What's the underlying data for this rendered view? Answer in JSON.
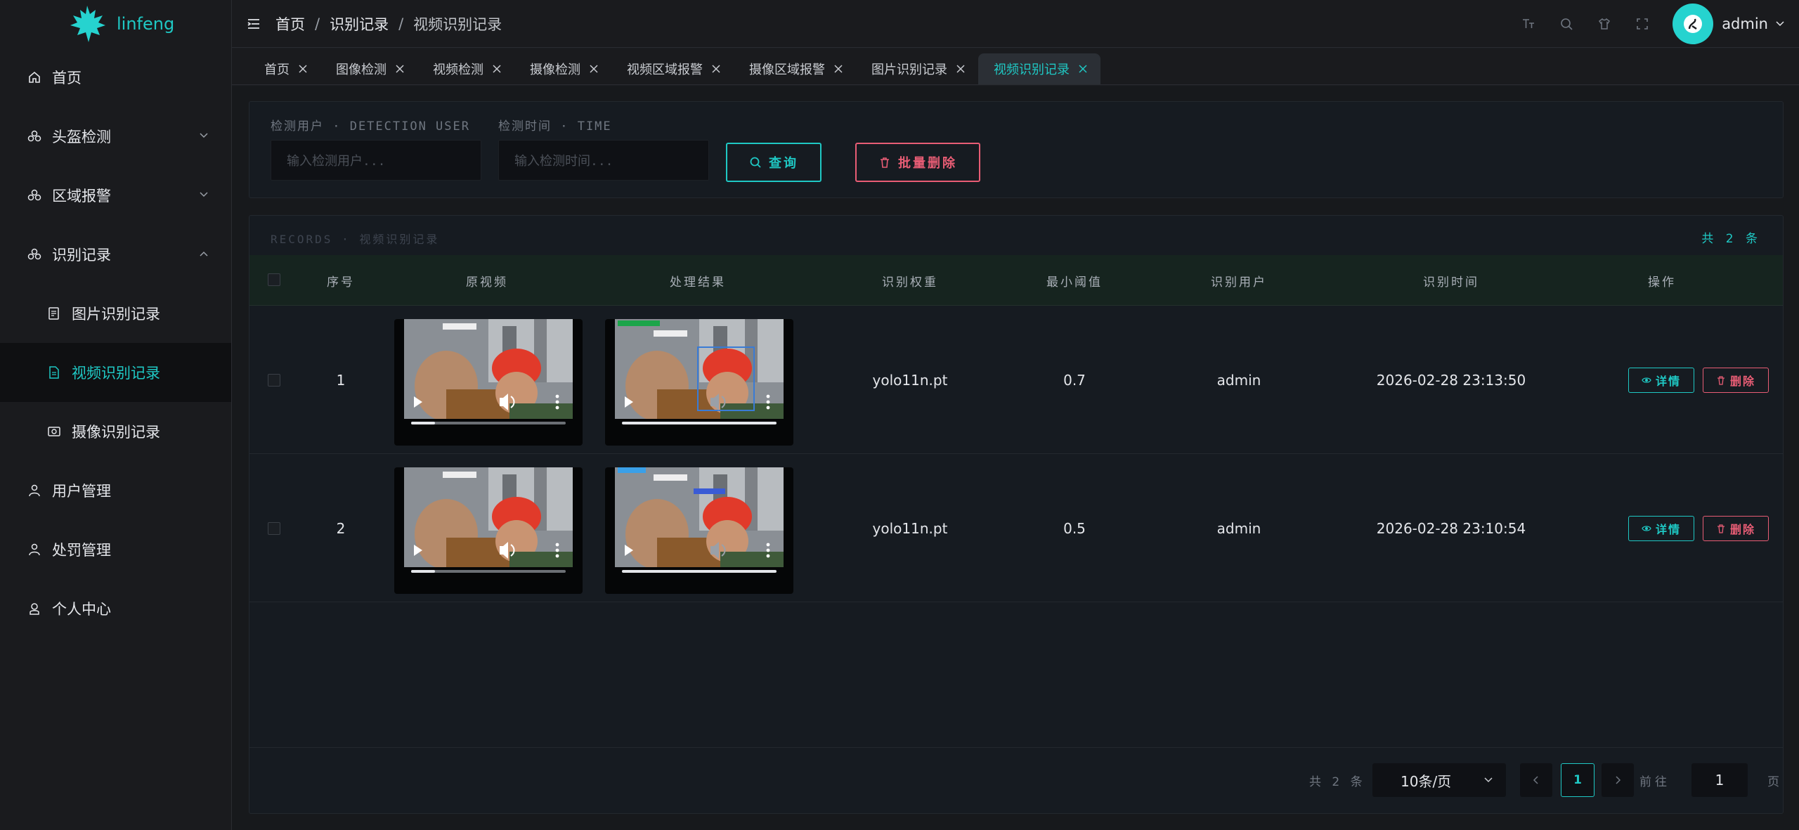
{
  "app": {
    "name": "linfeng"
  },
  "sidebar": {
    "items": [
      {
        "label": "首页",
        "icon": "home-icon"
      },
      {
        "label": "头盔检测",
        "icon": "helmet-icon"
      },
      {
        "label": "区域报警",
        "icon": "helmet-icon"
      },
      {
        "label": "识别记录",
        "icon": "helmet-icon"
      },
      {
        "label": "图片识别记录",
        "icon": "image-record-icon"
      },
      {
        "label": "视频识别记录",
        "icon": "video-record-icon"
      },
      {
        "label": "摄像识别记录",
        "icon": "camera-record-icon"
      },
      {
        "label": "用户管理",
        "icon": "user-icon"
      },
      {
        "label": "处罚管理",
        "icon": "user-icon"
      },
      {
        "label": "个人中心",
        "icon": "person-icon"
      }
    ],
    "active": "视频识别记录"
  },
  "header": {
    "breadcrumb": [
      "首页",
      "识别记录",
      "视频识别记录"
    ],
    "separator": "/",
    "user": "admin"
  },
  "tabs": [
    {
      "label": "首页"
    },
    {
      "label": "图像检测"
    },
    {
      "label": "视频检测"
    },
    {
      "label": "摄像检测"
    },
    {
      "label": "视频区域报警"
    },
    {
      "label": "摄像区域报警"
    },
    {
      "label": "图片识别记录"
    },
    {
      "label": "视频识别记录",
      "active": true
    }
  ],
  "search": {
    "user_label": "检测用户 · DETECTION USER",
    "time_label": "检测时间 · TIME",
    "user_placeholder": "输入检测用户...",
    "time_placeholder": "输入检测时间...",
    "search_button": "查询",
    "delete_button": "批量删除"
  },
  "table": {
    "title": "RECORDS · 视频识别记录",
    "count": "共 2 条",
    "headers": [
      "序号",
      "原视频",
      "处理结果",
      "识别权重",
      "最小阈值",
      "识别用户",
      "识别时间",
      "操作"
    ],
    "rows": [
      {
        "index": "1",
        "weight": "yolo11n.pt",
        "threshold": "0.7",
        "user": "admin",
        "time": "2026-02-28 23:13:50"
      },
      {
        "index": "2",
        "weight": "yolo11n.pt",
        "threshold": "0.5",
        "user": "admin",
        "time": "2026-02-28 23:10:54"
      }
    ],
    "detail_label": "详情",
    "delete_label": "删除"
  },
  "pagination": {
    "total": "共 2 条",
    "page_size": "10条/页",
    "current_page": "1",
    "goto_label": "前往",
    "goto_value": "1",
    "page_suffix": "页"
  },
  "colors": {
    "accent": "#1fc8c4",
    "danger": "#e85d75",
    "background": "#17191c"
  }
}
